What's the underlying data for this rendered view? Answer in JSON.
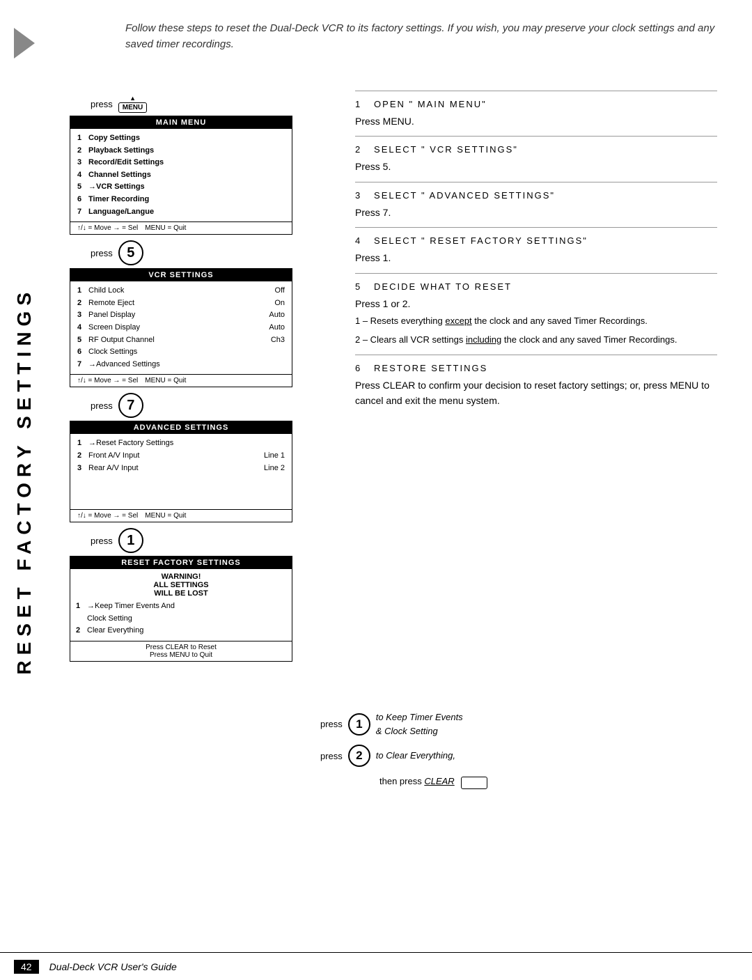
{
  "page": {
    "vertical_title": "RESET FACTORY SETTINGS",
    "triangle_arrow": true,
    "footer_page": "42",
    "footer_title": "Dual-Deck VCR User's Guide"
  },
  "intro": {
    "text": "Follow these steps to reset the Dual-Deck VCR to its factory settings. If you wish, you may preserve your clock settings and any saved timer recordings."
  },
  "diagrams": {
    "step1_press_label": "press",
    "step1_menu_label": "MENU",
    "main_menu": {
      "title": "MAIN MENU",
      "items": [
        {
          "num": "1",
          "text": "Copy Settings",
          "value": "",
          "bold": true
        },
        {
          "num": "2",
          "text": "Playback Settings",
          "value": "",
          "bold": true
        },
        {
          "num": "3",
          "text": "Record/Edit Settings",
          "value": "",
          "bold": true
        },
        {
          "num": "4",
          "text": "Channel Settings",
          "value": "",
          "bold": true
        },
        {
          "num": "5",
          "text": "→VCR Settings",
          "value": "",
          "bold": true
        },
        {
          "num": "6",
          "text": "Timer Recording",
          "value": "",
          "bold": true
        },
        {
          "num": "7",
          "text": "Language/Langue",
          "value": "",
          "bold": true
        }
      ],
      "nav": "↑/↓ = Move  → = Sel    MENU = Quit"
    },
    "step2_press_label": "press",
    "step2_number": "5",
    "vcr_settings": {
      "title": "VCR SETTINGS",
      "items": [
        {
          "num": "1",
          "text": "Child Lock",
          "value": "Off"
        },
        {
          "num": "2",
          "text": "Remote Eject",
          "value": "On"
        },
        {
          "num": "3",
          "text": "Panel Display",
          "value": "Auto"
        },
        {
          "num": "4",
          "text": "Screen Display",
          "value": "Auto"
        },
        {
          "num": "5",
          "text": "RF Output Channel",
          "value": "Ch3"
        },
        {
          "num": "6",
          "text": "Clock Settings",
          "value": ""
        },
        {
          "num": "7",
          "text": "→Advanced Settings",
          "value": ""
        }
      ],
      "nav": "↑/↓ = Move  → = Sel    MENU = Quit"
    },
    "step3_press_label": "press",
    "step3_number": "7",
    "advanced_settings": {
      "title": "ADVANCED SETTINGS",
      "items": [
        {
          "num": "1",
          "text": "→Reset Factory Settings",
          "value": ""
        },
        {
          "num": "2",
          "text": "Front A/V Input",
          "value": "Line 1"
        },
        {
          "num": "3",
          "text": "Rear A/V Input",
          "value": "Line 2"
        }
      ],
      "nav": "↑/↓ = Move  → = Sel    MENU = Quit"
    },
    "step4_press_label": "press",
    "step4_number": "1",
    "reset_factory": {
      "title": "RESET FACTORY SETTINGS",
      "warning": "WARNING!",
      "warning2": "ALL SETTINGS",
      "warning3": "WILL BE LOST",
      "items": [
        {
          "num": "1",
          "text": "→Keep Timer Events And",
          "value": ""
        },
        {
          "num": "",
          "text": "   Clock Setting",
          "value": ""
        },
        {
          "num": "2",
          "text": "Clear Everything",
          "value": ""
        }
      ],
      "footer1": "Press CLEAR to Reset",
      "footer2": "Press MENU to Quit"
    }
  },
  "steps": {
    "step1": {
      "number": "1",
      "title": "OPEN \"MAIN MENU\"",
      "body": "Press MENU."
    },
    "step2": {
      "number": "2",
      "title": "SELECT \"VCR SETTINGS\"",
      "body": "Press 5."
    },
    "step3": {
      "number": "3",
      "title": "SELECT \"ADVANCED SETTINGS\"",
      "body": "Press 7."
    },
    "step4": {
      "number": "4",
      "title": "SELECT \"RESET FACTORY SETTINGS\"",
      "body": "Press 1."
    },
    "step5": {
      "number": "5",
      "title": "DECIDE WHAT TO RESET",
      "body": "Press 1 or 2.",
      "detail1": "1 – Resets everything except the clock and any saved Timer Recordings.",
      "detail2": "2 – Clears all VCR settings including the clock and any saved Timer Recordings.",
      "underline_except": "except",
      "underline_including": "including"
    },
    "step6": {
      "number": "6",
      "title": "RESTORE SETTINGS",
      "body": "Press CLEAR to confirm your decision to reset factory settings; or, press MENU to cancel and exit the menu system."
    }
  },
  "bottom": {
    "press1_label": "press",
    "press1_number": "1",
    "press1_text": "to Keep Timer Events & Clock Setting",
    "press2_label": "press",
    "press2_number": "2",
    "press2_text": "to Clear Everything,",
    "press2_text2": "then press",
    "press2_clear": "CLEAR"
  }
}
